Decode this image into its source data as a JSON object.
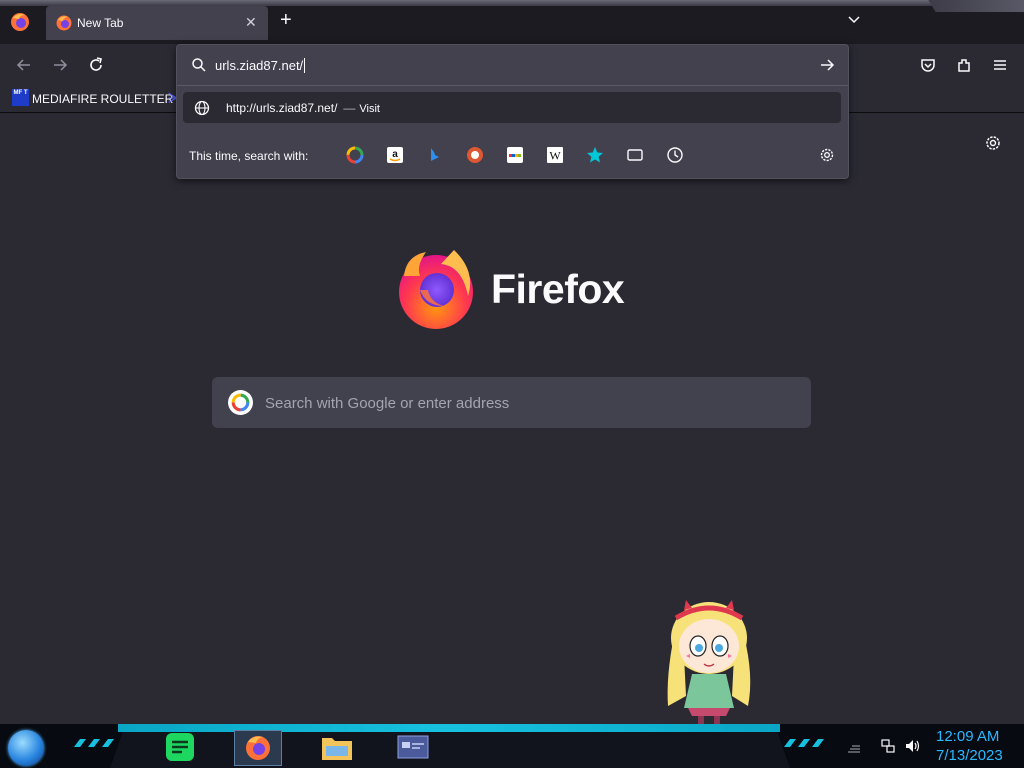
{
  "browser": {
    "tab": {
      "title": "New Tab"
    },
    "urlbar": {
      "value": "urls.ziad87.net/",
      "result": {
        "url": "http://urls.ziad87.net/",
        "separator": "—",
        "action": "Visit"
      },
      "oneoff_label": "This time, search with:",
      "engines": [
        {
          "name": "Google",
          "icon": "google-icon"
        },
        {
          "name": "Amazon",
          "icon": "amazon-icon"
        },
        {
          "name": "Bing",
          "icon": "bing-icon"
        },
        {
          "name": "DuckDuckGo",
          "icon": "duckduckgo-icon"
        },
        {
          "name": "eBay",
          "icon": "ebay-icon"
        },
        {
          "name": "Wikipedia",
          "icon": "wikipedia-icon",
          "glyph": "W"
        },
        {
          "name": "Bookmarks",
          "icon": "bookmarks-star-icon"
        },
        {
          "name": "Tabs",
          "icon": "tabs-icon"
        },
        {
          "name": "History",
          "icon": "history-icon"
        }
      ]
    },
    "bookmarks": [
      {
        "icon_text": "MF T",
        "label": "MEDIAFIRE ROULETTER"
      }
    ]
  },
  "newtab": {
    "wordmark": "Firefox",
    "search_placeholder": "Search with Google or enter address"
  },
  "taskbar": {
    "apps": [
      "spotify",
      "firefox",
      "file-explorer",
      "app-window"
    ],
    "active_app": "firefox",
    "clock": {
      "time": "12:09 AM",
      "date": "7/13/2023"
    }
  },
  "colors": {
    "toolbar": "#2b2a33",
    "tabstrip": "#1c1b22",
    "panel": "#42414d",
    "accent_taskbar": "#16c1df",
    "clock": "#2ab8ff"
  }
}
